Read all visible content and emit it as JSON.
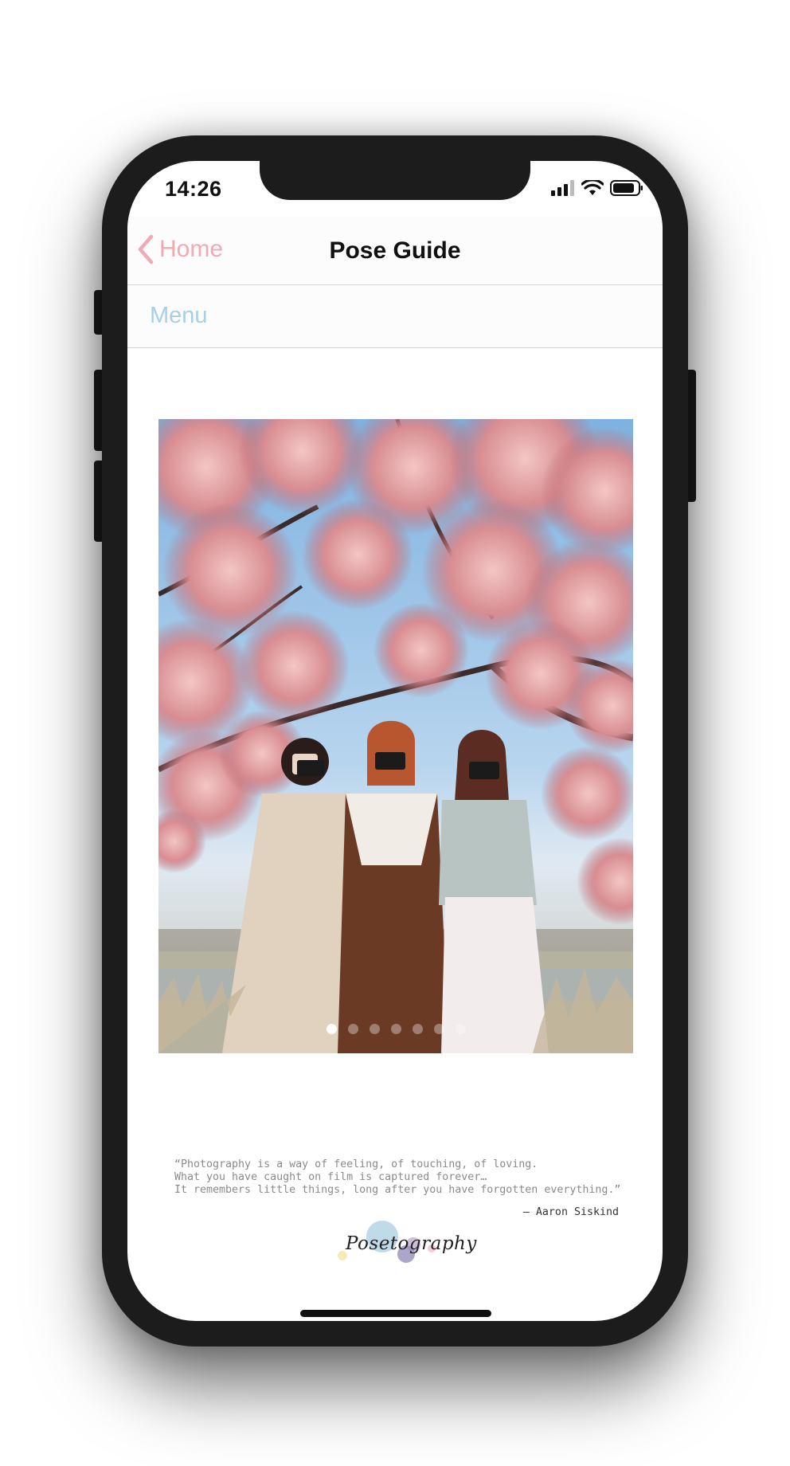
{
  "status_bar": {
    "time": "14:26",
    "signal_icon": "cellular-signal-icon",
    "wifi_icon": "wifi-icon",
    "battery_icon": "battery-icon"
  },
  "nav": {
    "back_icon": "chevron-left-icon",
    "back_label": "Home",
    "title": "Pose Guide"
  },
  "menu": {
    "label": "Menu"
  },
  "carousel": {
    "total_slides": 7,
    "active_index": 0
  },
  "quote": {
    "lines": [
      "“Photography is a way of feeling, of touching, of loving.",
      "What you have caught on film is captured forever…",
      "It remembers little things, long after you have forgotten everything.”"
    ],
    "author": "— Aaron Siskind"
  },
  "logo": {
    "text": "Posetography"
  },
  "colors": {
    "accent_pink": "#f1a9b3",
    "accent_blue": "#a8cfe5",
    "title": "#111111"
  }
}
